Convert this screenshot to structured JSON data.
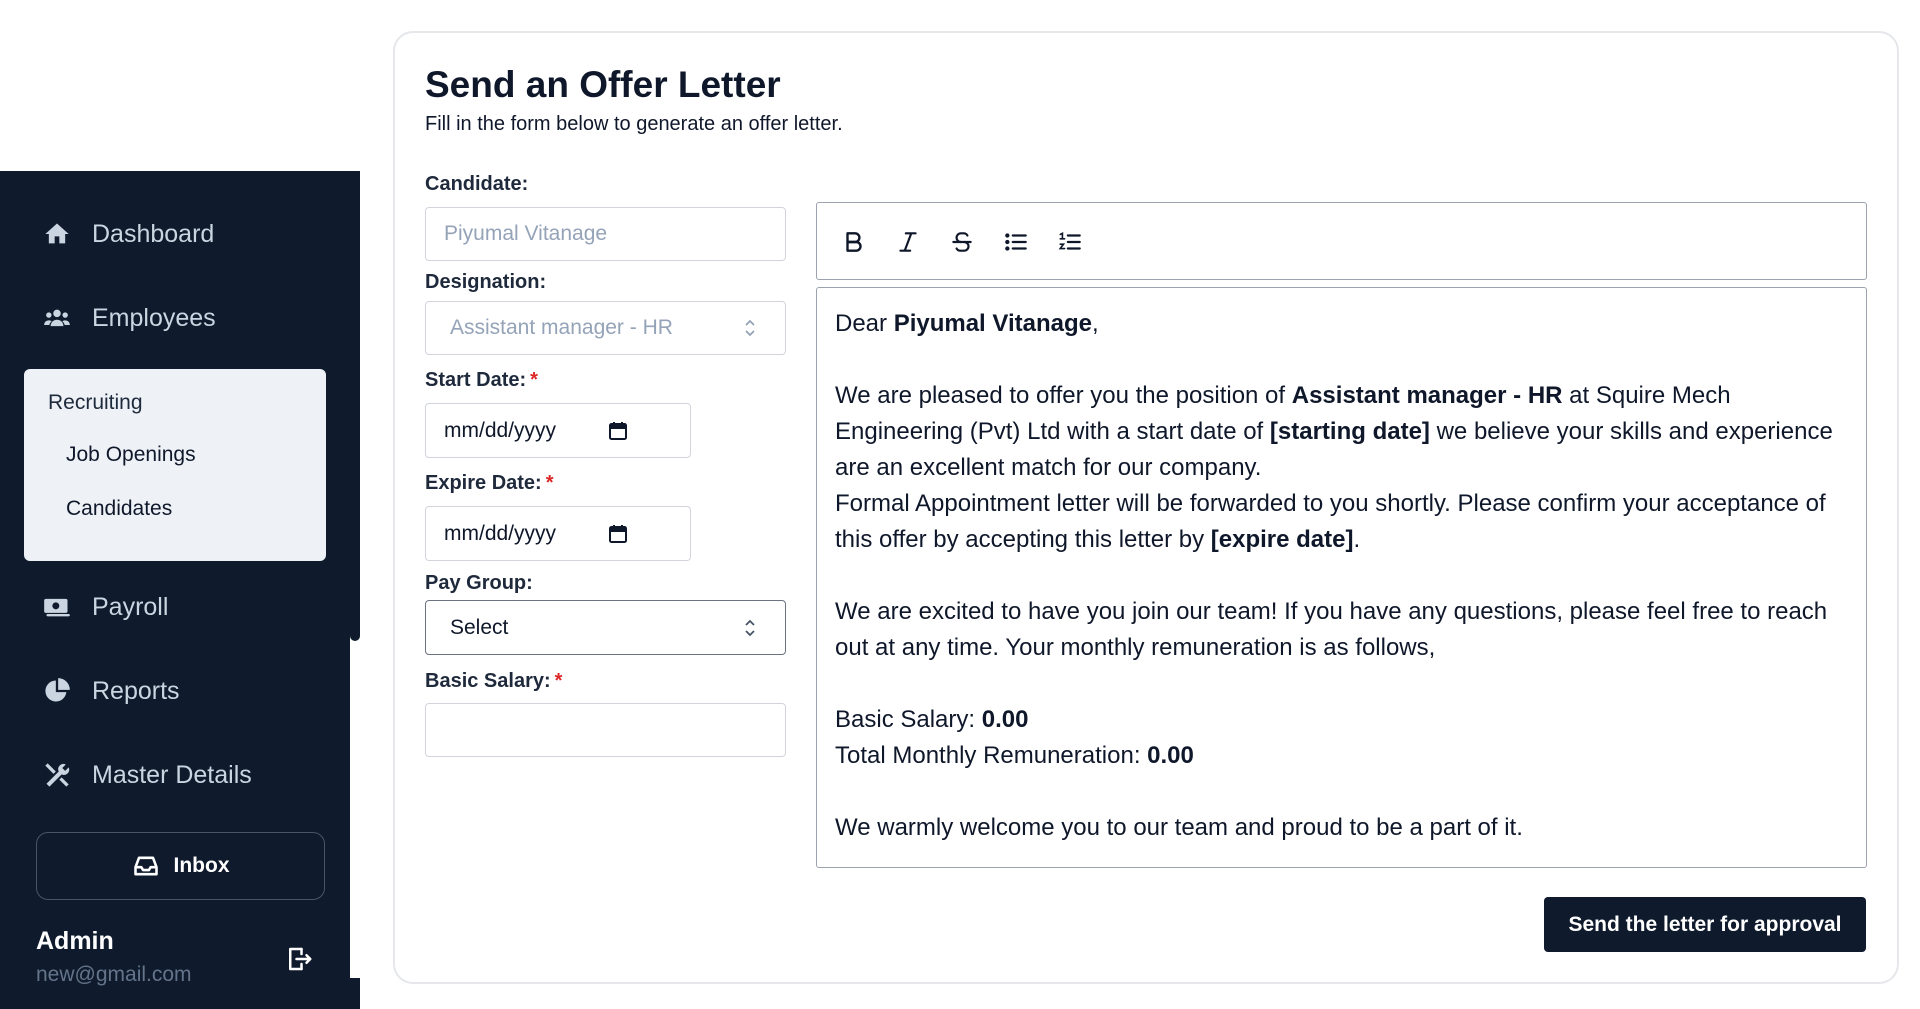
{
  "sidebar": {
    "nav": {
      "dashboard": "Dashboard",
      "employees": "Employees",
      "payroll": "Payroll",
      "reports": "Reports",
      "master_details": "Master Details"
    },
    "recruiting": {
      "title": "Recruiting",
      "job_openings": "Job Openings",
      "candidates": "Candidates"
    },
    "inbox_label": "Inbox",
    "user": {
      "name": "Admin",
      "email": "new@gmail.com"
    }
  },
  "page": {
    "title": "Send an Offer Letter",
    "subtitle": "Fill in the form below to generate an offer letter."
  },
  "form": {
    "candidate_label": "Candidate:",
    "candidate_placeholder": "Piyumal Vitanage",
    "designation_label": "Designation:",
    "designation_value": "Assistant manager - HR",
    "start_date_label": "Start Date:",
    "start_date_placeholder": "mm/dd/yyyy",
    "expire_date_label": "Expire Date:",
    "expire_date_placeholder": "mm/dd/yyyy",
    "pay_group_label": "Pay Group:",
    "pay_group_value": "Select",
    "basic_salary_label": "Basic Salary:",
    "basic_salary_value": "",
    "required_mark": "*"
  },
  "editor": {
    "toolbar": [
      "bold-icon",
      "italic-icon",
      "strikethrough-icon",
      "bullet-list-icon",
      "numbered-list-icon"
    ],
    "greeting_prefix": "Dear ",
    "candidate_name": "Piyumal Vitanage",
    "greeting_suffix": ",",
    "p1_a": "We are pleased to offer you the position of ",
    "designation": "Assistant manager - HR",
    "p1_b": " at Squire Mech Engineering (Pvt) Ltd with a start date of ",
    "starting_date": "[starting date]",
    "p1_c": " we believe your skills and experience are an excellent match for our company.",
    "p2_a": "Formal Appointment letter will be forwarded to you shortly. Please confirm your acceptance of this offer by accepting this letter by ",
    "expire_date": "[expire date]",
    "p2_b": ".",
    "p3": "We are excited to have you join our team! If you have any questions, please feel free to reach out at any time. Your monthly remuneration is as follows,",
    "basic_salary_label": "Basic Salary: ",
    "basic_salary": "0.00",
    "total_label": "Total Monthly Remuneration: ",
    "total": "0.00",
    "closing": "We warmly welcome you to our team and proud to be a part of it."
  },
  "actions": {
    "send_label": "Send the letter for approval"
  },
  "colors": {
    "sidebar_bg": "#0f1b2d",
    "required": "#dc2626",
    "primary_button": "#0f1b2d"
  }
}
